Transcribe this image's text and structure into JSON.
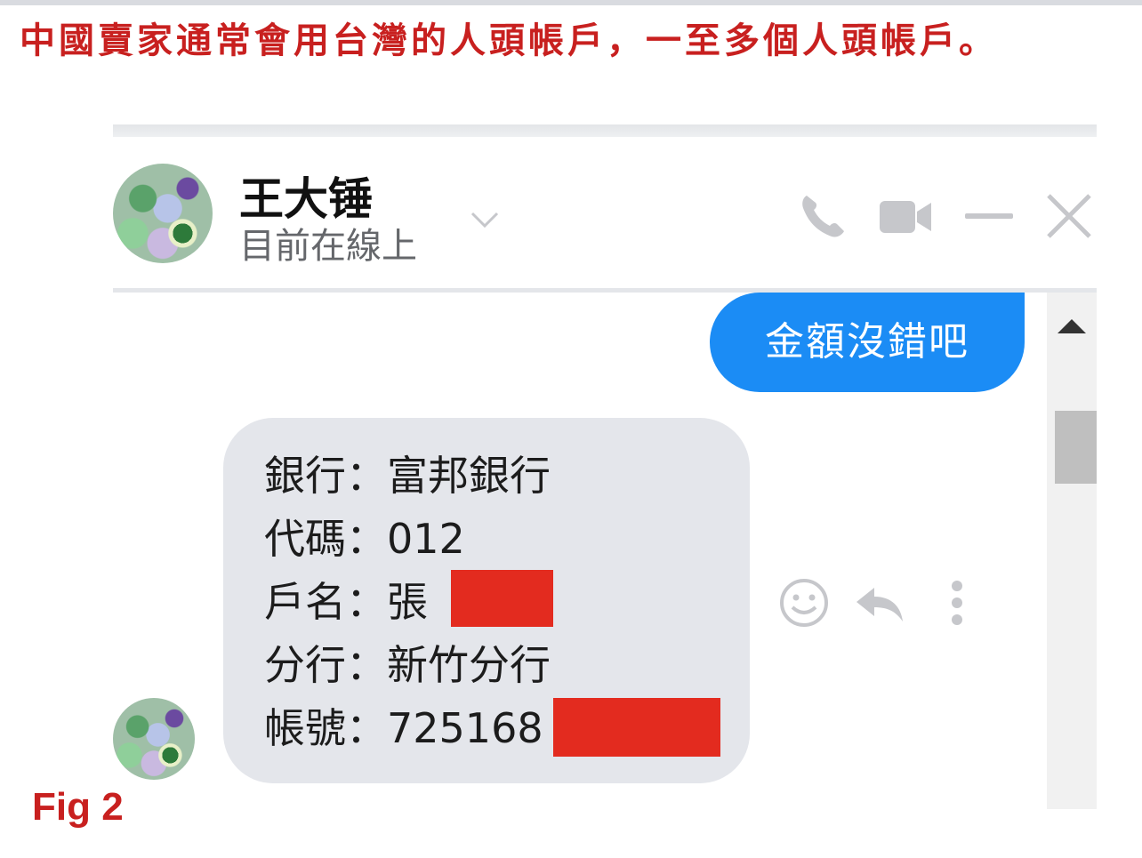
{
  "caption": "中國賣家通常會用台灣的人頭帳戶，一至多個人頭帳戶。",
  "chat_header": {
    "contact_name": "王大锤",
    "status": "目前在線上",
    "icons": [
      "chevron-down-icon",
      "phone-icon",
      "video-camera-icon",
      "minimize-icon",
      "close-icon"
    ]
  },
  "messages": {
    "outgoing": {
      "text": "金額沒錯吧"
    },
    "incoming": {
      "lines": [
        "銀行：富邦銀行",
        "代碼：012",
        "戶名：張",
        "分行：新竹分行",
        "帳號：725168"
      ],
      "redacted": true
    },
    "actions": [
      "smiley-icon",
      "reply-icon",
      "more-vertical-icon"
    ]
  },
  "colors": {
    "caption_red": "#c8201f",
    "outgoing_bubble": "#1b8cf5",
    "incoming_bubble": "#e4e6eb",
    "redaction": "#e32b1f",
    "icon_gray": "#c6c7cb"
  },
  "figure_label": "Fig 2"
}
